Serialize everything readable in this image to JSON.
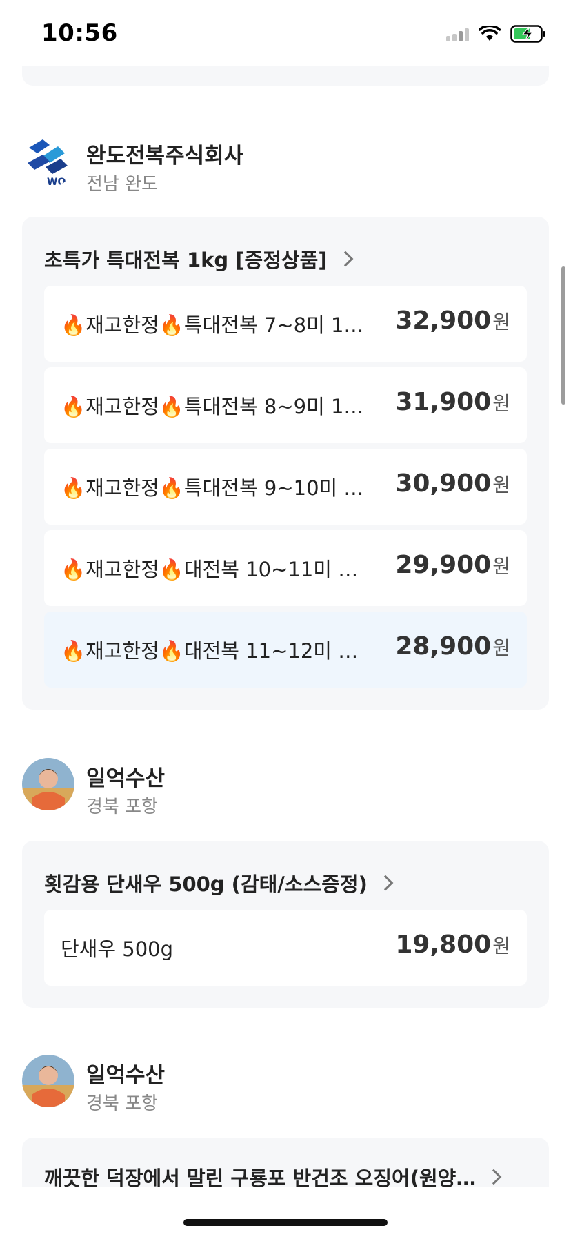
{
  "status_bar": {
    "time": "10:56"
  },
  "sellers": [
    {
      "name": "완도전복주식회사",
      "region": "전남 완도",
      "avatar_icon": "wando-logo-icon",
      "product": {
        "title": "초특가 특대전복 1kg [증정상품]",
        "options": [
          {
            "name": "🔥재고한정🔥특대전복 7~8미 1…",
            "price": "32,900",
            "unit": "원"
          },
          {
            "name": "🔥재고한정🔥특대전복 8~9미 1…",
            "price": "31,900",
            "unit": "원"
          },
          {
            "name": "🔥재고한정🔥특대전복 9~10미 …",
            "price": "30,900",
            "unit": "원"
          },
          {
            "name": "🔥재고한정🔥대전복 10~11미 …",
            "price": "29,900",
            "unit": "원"
          },
          {
            "name": "🔥재고한정🔥대전복 11~12미 …",
            "price": "28,900",
            "unit": "원"
          }
        ]
      }
    },
    {
      "name": "일억수산",
      "region": "경북 포항",
      "avatar_icon": "seller-photo-avatar",
      "product": {
        "title": "횟감용 단새우 500g (감태/소스증정)",
        "options": [
          {
            "name": "단새우 500g",
            "price": "19,800",
            "unit": "원"
          }
        ]
      }
    },
    {
      "name": "일억수산",
      "region": "경북 포항",
      "avatar_icon": "seller-photo-avatar",
      "product": {
        "title": "깨끗한 덕장에서 말린 구룡포 반건조 오징어(원양…"
      }
    }
  ],
  "colors": {
    "card_bg": "#f6f7f9",
    "highlight_bg": "#eff6fd",
    "logo_blue": "#1a56b8"
  }
}
